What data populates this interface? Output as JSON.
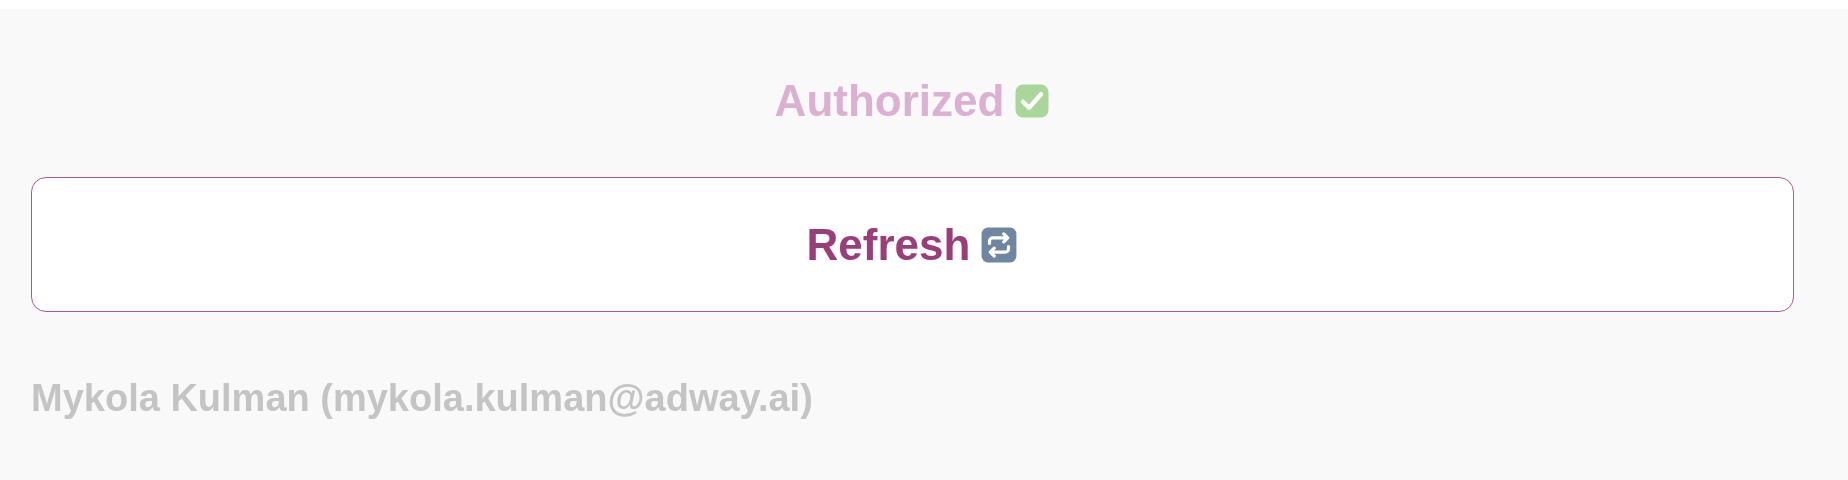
{
  "status": {
    "label": "Authorized",
    "checked": true
  },
  "refresh_button": {
    "label": "Refresh"
  },
  "account": {
    "text": "Mykola Kulman (mykola.kulman@adway.ai)"
  }
}
